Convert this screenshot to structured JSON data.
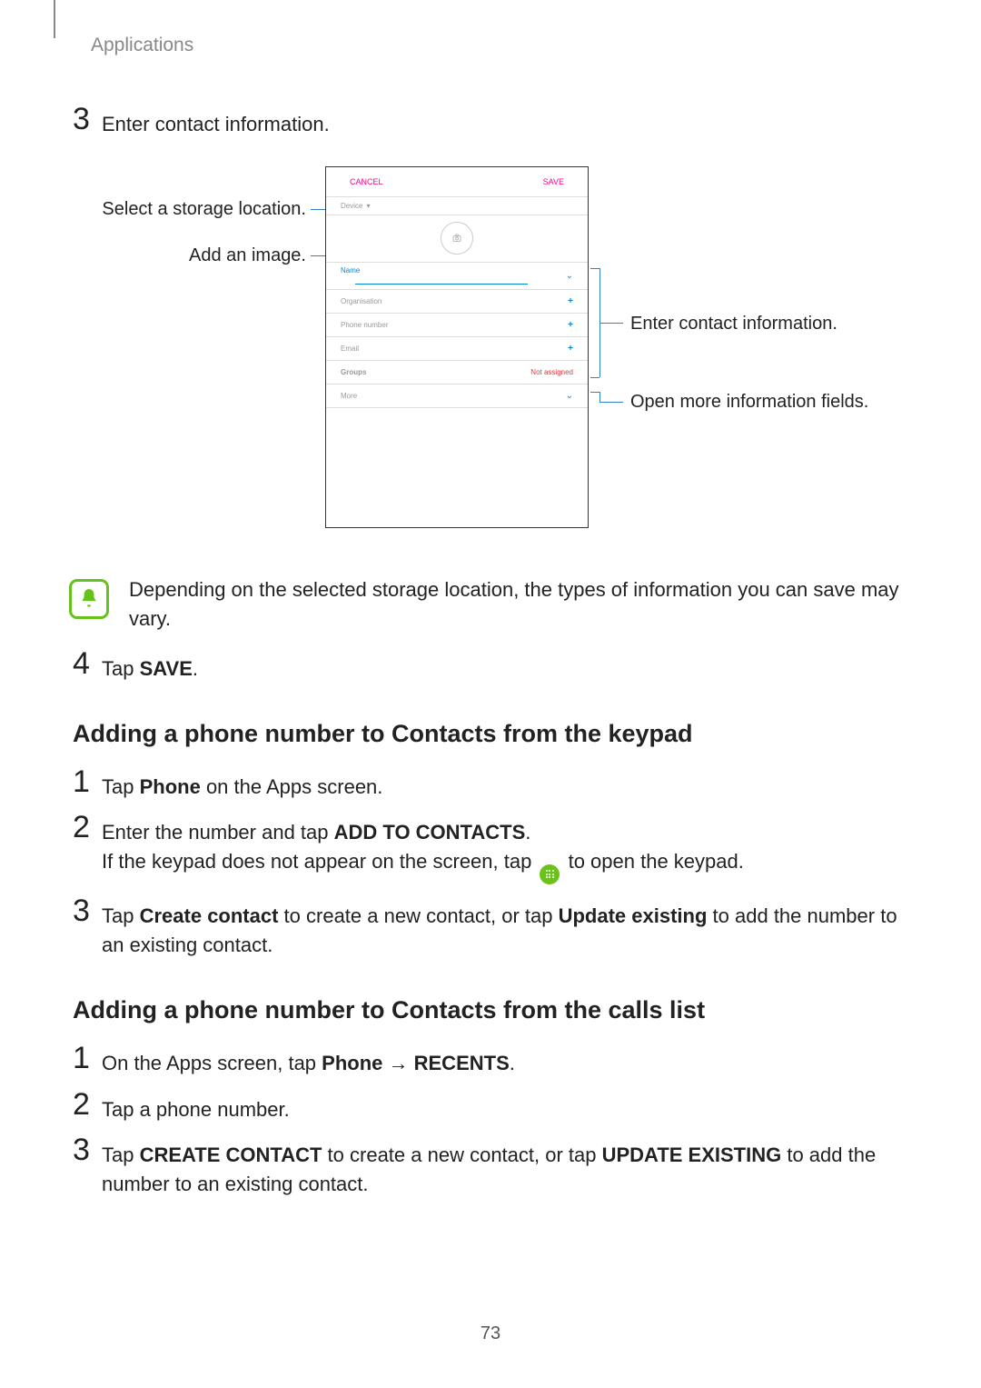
{
  "header": {
    "breadcrumb": "Applications"
  },
  "page_number": "73",
  "top_steps": {
    "step3": {
      "num": "3",
      "text": "Enter contact information."
    },
    "step4": {
      "num": "4",
      "prefix": "Tap ",
      "bold": "SAVE",
      "suffix": "."
    }
  },
  "diagram": {
    "phone": {
      "cancel": "CANCEL",
      "save": "SAVE",
      "device": "Device",
      "name": "Name",
      "organisation": "Organisation",
      "phone_number": "Phone number",
      "email": "Email",
      "groups": "Groups",
      "not_assigned": "Not assigned",
      "more": "More"
    },
    "callouts": {
      "storage": "Select a storage location.",
      "image": "Add an image.",
      "info": "Enter contact information.",
      "more_fields": "Open more information fields."
    }
  },
  "note": "Depending on the selected storage location, the types of information you can save may vary.",
  "section_keypad": {
    "heading": "Adding a phone number to Contacts from the keypad",
    "s1": {
      "num": "1",
      "p1": "Tap ",
      "b1": "Phone",
      "p2": " on the Apps screen."
    },
    "s2": {
      "num": "2",
      "p1": "Enter the number and tap ",
      "b1": "ADD TO CONTACTS",
      "p2": ".",
      "line2a": "If the keypad does not appear on the screen, tap ",
      "line2b": " to open the keypad."
    },
    "s3": {
      "num": "3",
      "p1": "Tap ",
      "b1": "Create contact",
      "p2": " to create a new contact, or tap ",
      "b2": "Update existing",
      "p3": " to add the number to an existing contact."
    }
  },
  "section_calls": {
    "heading": "Adding a phone number to Contacts from the calls list",
    "s1": {
      "num": "1",
      "p1": "On the Apps screen, tap ",
      "b1": "Phone",
      "p2": " → ",
      "b2": "RECENTS",
      "p3": "."
    },
    "s2": {
      "num": "2",
      "text": "Tap a phone number."
    },
    "s3": {
      "num": "3",
      "p1": "Tap ",
      "b1": "CREATE CONTACT",
      "p2": " to create a new contact, or tap ",
      "b2": "UPDATE EXISTING",
      "p3": " to add the number to an existing contact."
    }
  }
}
